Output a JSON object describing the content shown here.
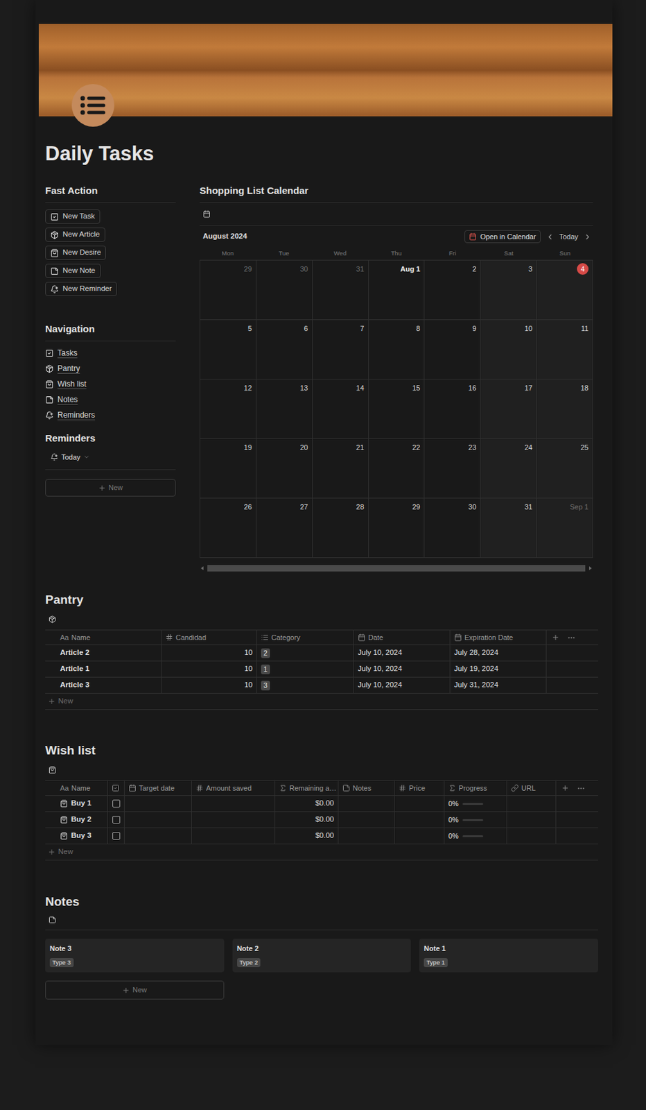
{
  "page": {
    "title": "Daily Tasks"
  },
  "fast_action": {
    "title": "Fast Action",
    "buttons": [
      {
        "label": "New Task",
        "kind": "task"
      },
      {
        "label": "New Article",
        "kind": "article"
      },
      {
        "label": "New Desire",
        "kind": "desire"
      },
      {
        "label": "New Note",
        "kind": "note"
      },
      {
        "label": "New Reminder",
        "kind": "reminder"
      }
    ]
  },
  "navigation": {
    "title": "Navigation",
    "items": [
      {
        "label": "Tasks",
        "kind": "task"
      },
      {
        "label": "Pantry",
        "kind": "article"
      },
      {
        "label": "Wish list",
        "kind": "desire"
      },
      {
        "label": "Notes",
        "kind": "note"
      },
      {
        "label": "Reminders",
        "kind": "reminder"
      }
    ]
  },
  "reminders": {
    "title": "Reminders",
    "view": {
      "label": "Today",
      "selected": true
    },
    "new_label": "New"
  },
  "calendar": {
    "title": "Shopping List Calendar",
    "month": "August 2024",
    "open_label": "Open in Calendar",
    "today_label": "Today",
    "weekdays": [
      {
        "label": "Mon",
        "weekend": false
      },
      {
        "label": "Tue",
        "weekend": false
      },
      {
        "label": "Wed",
        "weekend": false
      },
      {
        "label": "Thu",
        "weekend": false
      },
      {
        "label": "Fri",
        "weekend": false
      },
      {
        "label": "Sat",
        "weekend": true
      },
      {
        "label": "Sun",
        "weekend": true
      }
    ],
    "weeks": [
      [
        {
          "label": "29",
          "in_month": false,
          "today": false
        },
        {
          "label": "30",
          "in_month": false,
          "today": false
        },
        {
          "label": "31",
          "in_month": false,
          "today": false
        },
        {
          "label": "Aug 1",
          "in_month": true,
          "today": false
        },
        {
          "label": "2",
          "in_month": true,
          "today": false
        },
        {
          "label": "3",
          "in_month": true,
          "today": false
        },
        {
          "label": "4",
          "in_month": true,
          "today": true
        }
      ],
      [
        {
          "label": "5",
          "in_month": true,
          "today": false
        },
        {
          "label": "6",
          "in_month": true,
          "today": false
        },
        {
          "label": "7",
          "in_month": true,
          "today": false
        },
        {
          "label": "8",
          "in_month": true,
          "today": false
        },
        {
          "label": "9",
          "in_month": true,
          "today": false
        },
        {
          "label": "10",
          "in_month": true,
          "today": false
        },
        {
          "label": "11",
          "in_month": true,
          "today": false
        }
      ],
      [
        {
          "label": "12",
          "in_month": true,
          "today": false
        },
        {
          "label": "13",
          "in_month": true,
          "today": false
        },
        {
          "label": "14",
          "in_month": true,
          "today": false
        },
        {
          "label": "15",
          "in_month": true,
          "today": false
        },
        {
          "label": "16",
          "in_month": true,
          "today": false
        },
        {
          "label": "17",
          "in_month": true,
          "today": false
        },
        {
          "label": "18",
          "in_month": true,
          "today": false
        }
      ],
      [
        {
          "label": "19",
          "in_month": true,
          "today": false
        },
        {
          "label": "20",
          "in_month": true,
          "today": false
        },
        {
          "label": "21",
          "in_month": true,
          "today": false
        },
        {
          "label": "22",
          "in_month": true,
          "today": false
        },
        {
          "label": "23",
          "in_month": true,
          "today": false
        },
        {
          "label": "24",
          "in_month": true,
          "today": false
        },
        {
          "label": "25",
          "in_month": true,
          "today": false
        }
      ],
      [
        {
          "label": "26",
          "in_month": true,
          "today": false
        },
        {
          "label": "27",
          "in_month": true,
          "today": false
        },
        {
          "label": "28",
          "in_month": true,
          "today": false
        },
        {
          "label": "29",
          "in_month": true,
          "today": false
        },
        {
          "label": "30",
          "in_month": true,
          "today": false
        },
        {
          "label": "31",
          "in_month": true,
          "today": false
        },
        {
          "label": "Sep 1",
          "in_month": false,
          "today": false
        }
      ]
    ]
  },
  "pantry": {
    "title": "Pantry",
    "columns": [
      {
        "label": "Name",
        "kind": "title",
        "icon_text": "Aa"
      },
      {
        "label": "Candidad",
        "kind": "number"
      },
      {
        "label": "Category",
        "kind": "select"
      },
      {
        "label": "Date",
        "kind": "date"
      },
      {
        "label": "Expiration Date",
        "kind": "date"
      }
    ],
    "rows": [
      {
        "name": "Article 2",
        "quantity": "10",
        "category": "2",
        "date": "July 10, 2024",
        "expiration": "July 28, 2024"
      },
      {
        "name": "Article 1",
        "quantity": "10",
        "category": "1",
        "date": "July 10, 2024",
        "expiration": "July 19, 2024"
      },
      {
        "name": "Article 3",
        "quantity": "10",
        "category": "3",
        "date": "July 10, 2024",
        "expiration": "July 31, 2024"
      }
    ],
    "new_label": "New"
  },
  "wish_list": {
    "title": "Wish list",
    "columns": [
      {
        "label": "Name",
        "kind": "title",
        "icon_text": "Aa"
      },
      {
        "kind": "checkbox"
      },
      {
        "label": "Target date",
        "kind": "date"
      },
      {
        "label": "Amount saved",
        "kind": "number"
      },
      {
        "label": "Remaining a…",
        "kind": "formula"
      },
      {
        "label": "Notes",
        "kind": "text"
      },
      {
        "label": "Price",
        "kind": "number"
      },
      {
        "label": "Progress",
        "kind": "formula"
      },
      {
        "label": "URL",
        "kind": "url"
      }
    ],
    "rows": [
      {
        "name": "Buy 1",
        "checked": false,
        "remaining": "$0.00",
        "progress": "0%",
        "level": 0
      },
      {
        "name": "Buy 2",
        "checked": false,
        "remaining": "$0.00",
        "progress": "0%",
        "level": 0
      },
      {
        "name": "Buy 3",
        "checked": false,
        "remaining": "$0.00",
        "progress": "0%",
        "level": 0
      }
    ],
    "new_label": "New"
  },
  "notes": {
    "title": "Notes",
    "cards": [
      {
        "title": "Note 3",
        "tag": "Type 3"
      },
      {
        "title": "Note 2",
        "tag": "Type 2"
      },
      {
        "title": "Note 1",
        "tag": "Type 1"
      }
    ],
    "new_label": "New"
  }
}
